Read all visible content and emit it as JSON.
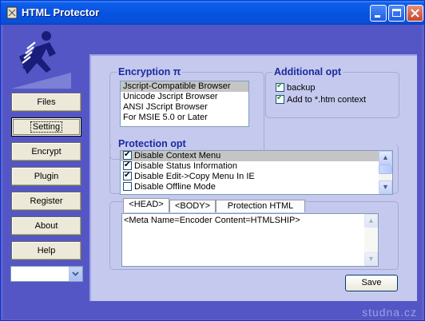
{
  "window": {
    "title": "HTML Protector"
  },
  "titlebar": {
    "buttons": [
      "minimize",
      "maximize",
      "close"
    ]
  },
  "sidebar": {
    "items": [
      {
        "label": "Files"
      },
      {
        "label": "Setting"
      },
      {
        "label": "Encrypt"
      },
      {
        "label": "Plugin"
      },
      {
        "label": "Register"
      },
      {
        "label": "About"
      },
      {
        "label": "Help"
      }
    ],
    "selected": "Setting",
    "combo_value": ""
  },
  "encryption": {
    "title": "Encryption π",
    "options": [
      "Jscript-Compatible Browser",
      "Unicode Jscript Browser",
      "ANSI JScript Browser",
      "For MSIE 5.0 or Later"
    ],
    "selected_index": 0
  },
  "additional": {
    "title": "Additional opt",
    "options": [
      {
        "label": "backup",
        "checked": true
      },
      {
        "label": "Add to *.htm context",
        "checked": true
      }
    ]
  },
  "protection": {
    "title": "Protection opt",
    "options": [
      {
        "label": "Disable Context Menu",
        "checked": true
      },
      {
        "label": "Disable Status Information",
        "checked": true
      },
      {
        "label": "Disable Edit->Copy Menu In IE",
        "checked": true
      },
      {
        "label": "Disable Offline Mode",
        "checked": false
      }
    ],
    "selected_index": 0
  },
  "editor": {
    "tabs": [
      "<HEAD>",
      "<BODY>",
      "Protection HTML"
    ],
    "active_tab": "<HEAD>",
    "content": "<Meta Name=Encoder Content=HTMLSHIP>"
  },
  "actions": {
    "save_label": "Save"
  },
  "watermark": "studna.cz",
  "colors": {
    "titlebar": "#0553e1",
    "background": "#5456c6",
    "panel": "#c5c9ee",
    "group_title": "#1b2a9e"
  }
}
